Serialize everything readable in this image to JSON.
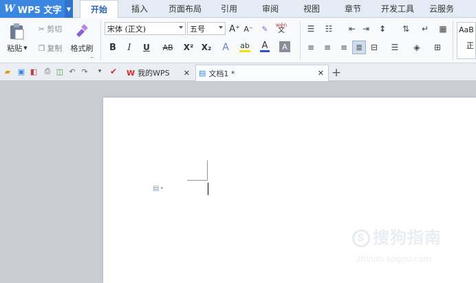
{
  "app": {
    "title": "WPS 文字",
    "logo": "W"
  },
  "menu_tabs": [
    {
      "label": "开始",
      "active": true
    },
    {
      "label": "插入"
    },
    {
      "label": "页面布局"
    },
    {
      "label": "引用"
    },
    {
      "label": "审阅"
    },
    {
      "label": "视图"
    },
    {
      "label": "章节"
    },
    {
      "label": "开发工具"
    },
    {
      "label": "云服务"
    }
  ],
  "clipboard": {
    "paste": "粘贴",
    "cut": "剪切",
    "copy": "复制",
    "format_painter": "格式刷"
  },
  "font": {
    "name": "宋体 (正文)",
    "size": "五号"
  },
  "formatting": {
    "bold": "B",
    "italic": "I",
    "underline": "U",
    "strike": "AB",
    "superscript": "X²",
    "subscript": "X₂",
    "font_color": "A",
    "highlight": "ab",
    "wen": "wén",
    "grow": "A⁺",
    "shrink": "A⁻"
  },
  "styles": {
    "preview": "AaB",
    "preview2": "正"
  },
  "doc_tabs": [
    {
      "label": "我的WPS"
    },
    {
      "label": "文档1 *"
    }
  ],
  "watermark": {
    "brand": "搜狗指南",
    "url": "zhinan.sogou.com"
  },
  "colors": {
    "accent": "#3a86e0",
    "font_color_bar": "#2b4fd6",
    "highlight_bar": "#f7e000",
    "wps_red": "#d72a2a"
  }
}
